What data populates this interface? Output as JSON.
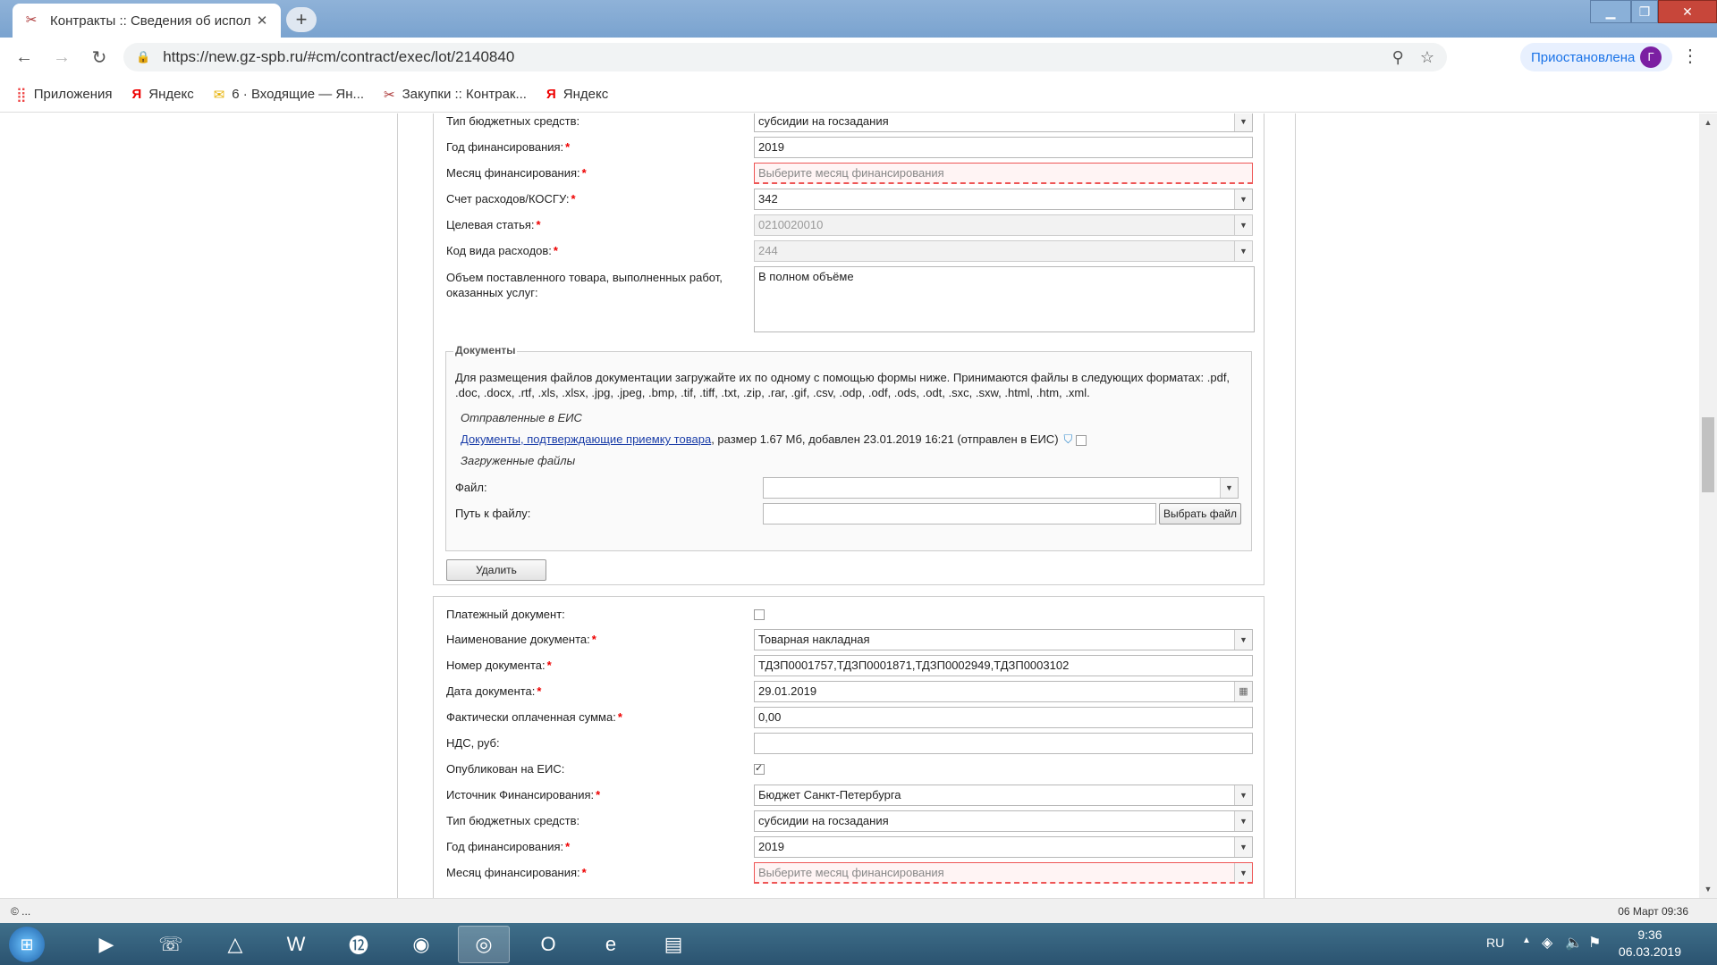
{
  "browser": {
    "tab_title": "Контракты :: Сведения об испол",
    "url": "https://new.gz-spb.ru/#cm/contract/exec/lot/2140840",
    "profile_status": "Приостановлена",
    "profile_initial": "Г"
  },
  "bookmarks": [
    {
      "label": "Приложения",
      "icon": "apps-icon"
    },
    {
      "label": "Яндекс",
      "icon": "yandex-icon"
    },
    {
      "label": "6 · Входящие — Ян...",
      "icon": "mail-icon"
    },
    {
      "label": "Закупки :: Контрак...",
      "icon": "gz-icon"
    },
    {
      "label": "Яндекс",
      "icon": "yandex-icon"
    }
  ],
  "form_top": {
    "budget_type": {
      "label": "Тип бюджетных средств:",
      "value": "субсидии на госзадания"
    },
    "fin_year": {
      "label": "Год финансирования:",
      "value": "2019"
    },
    "fin_month": {
      "label": "Месяц финансирования:",
      "placeholder": "Выберите месяц финансирования"
    },
    "kosgu": {
      "label": "Счет расходов/КОСГУ:",
      "value": "342"
    },
    "target_item": {
      "label": "Целевая статья:",
      "value": "0210020010"
    },
    "expense_code": {
      "label": "Код вида расходов:",
      "value": "244"
    },
    "volume": {
      "label": "Объем поставленного товара, выполненных работ, оказанных услуг:",
      "value": "В полном объёме"
    }
  },
  "documents": {
    "legend": "Документы",
    "info": "Для размещения файлов документации загружайте их по одному с помощью формы ниже. Принимаются файлы в следующих форматах: .pdf, .doc, .docx, .rtf, .xls, .xlsx, .jpg, .jpeg, .bmp, .tif, .tiff, .txt, .zip, .rar, .gif, .csv, .odp, .odf, .ods, .odt, .sxc, .sxw, .html, .htm, .xml.",
    "sent_heading": "Отправленные в ЕИС",
    "sent_link": "Документы, подтверждающие приемку товара",
    "sent_meta": ", размер 1.67 Мб, добавлен 23.01.2019 16:21 (отправлен в ЕИС)",
    "uploaded_heading": "Загруженные файлы",
    "file_label": "Файл:",
    "path_label": "Путь к файлу:",
    "choose_button": "Выбрать файл",
    "delete_button": "Удалить"
  },
  "form_bottom": {
    "payment_doc": {
      "label": "Платежный документ:"
    },
    "doc_name": {
      "label": "Наименование документа:",
      "value": "Товарная накладная"
    },
    "doc_number": {
      "label": "Номер документа:",
      "value": "ТДЗП0001757,ТДЗП0001871,ТДЗП0002949,ТДЗП0003102"
    },
    "doc_date": {
      "label": "Дата документа:",
      "value": "29.01.2019"
    },
    "paid_sum": {
      "label": "Фактически оплаченная сумма:",
      "value": "0,00"
    },
    "vat": {
      "label": "НДС, руб:",
      "value": ""
    },
    "published": {
      "label": "Опубликован на ЕИС:"
    },
    "fin_source": {
      "label": "Источник Финансирования:",
      "value": "Бюджет Санкт-Петербурга"
    },
    "budget_type": {
      "label": "Тип бюджетных средств:",
      "value": "субсидии на госзадания"
    },
    "fin_year": {
      "label": "Год финансирования:",
      "value": "2019"
    },
    "fin_month": {
      "label": "Месяц финансирования:",
      "placeholder": "Выберите месяц финансирования"
    }
  },
  "statusbar": {
    "left": "© ...",
    "right": "06 Март 09:36"
  },
  "taskbar": {
    "lang": "RU",
    "time": "9:36",
    "date": "06.03.2019"
  }
}
